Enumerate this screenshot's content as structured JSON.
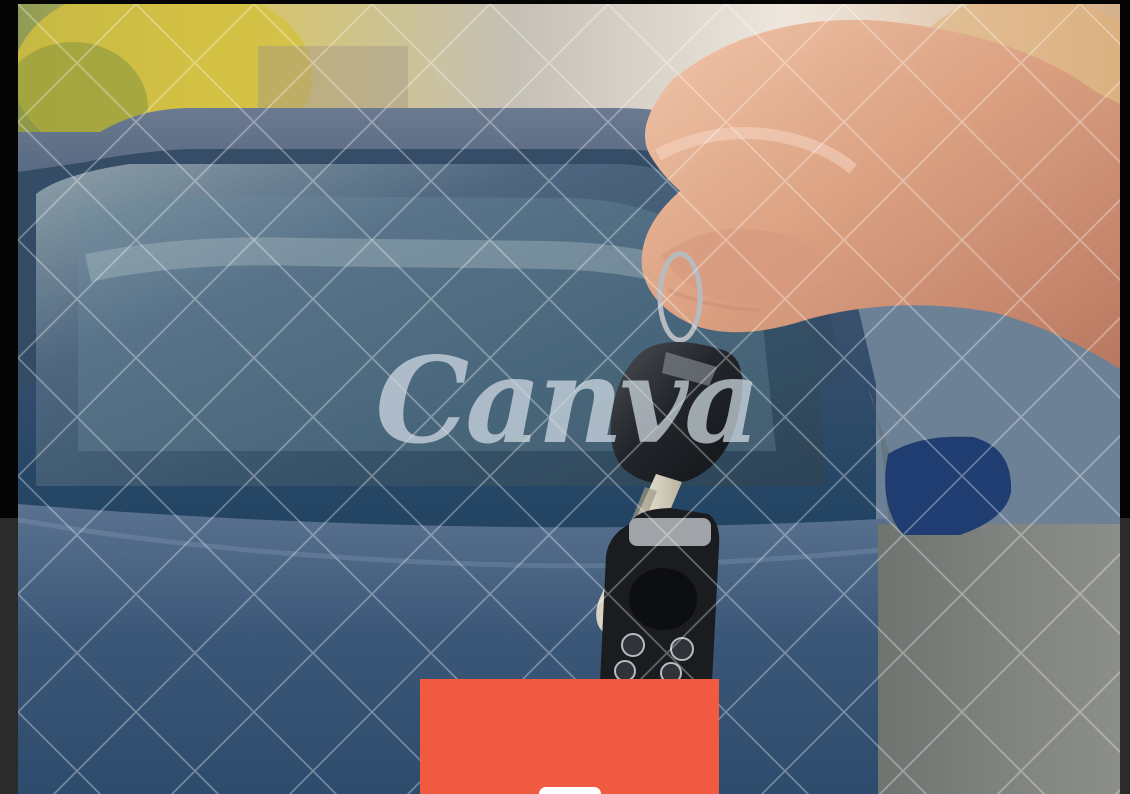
{
  "watermark": {
    "text": "Canva",
    "pattern": "diagonal-cross-lines"
  },
  "photo": {
    "subject": "hand-holding-car-keys-in-front-of-blue-car"
  },
  "colors": {
    "background_dark": "#2b2b2b",
    "top_band": "#050505",
    "accent": "#f05a40",
    "button": "#ffffff"
  }
}
